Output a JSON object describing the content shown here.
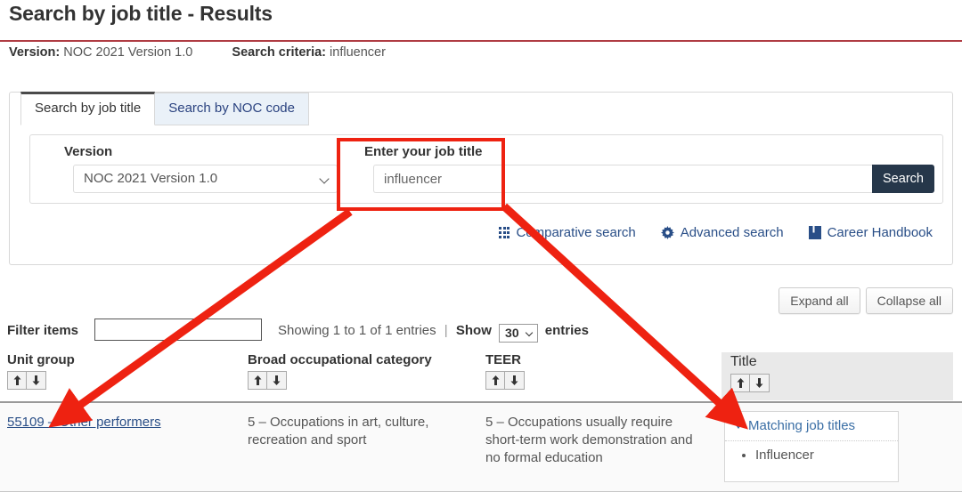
{
  "header": {
    "title": "Search by job title - Results",
    "version_label": "Version:",
    "version_value": "NOC 2021 Version 1.0",
    "criteria_label": "Search criteria:",
    "criteria_value": "influencer"
  },
  "tabs": [
    {
      "label": "Search by job title",
      "active": true
    },
    {
      "label": "Search by NOC code",
      "active": false
    }
  ],
  "form": {
    "version_label": "Version",
    "version_selected": "NOC 2021 Version 1.0",
    "jobtitle_label": "Enter your job title",
    "jobtitle_value": "influencer",
    "jobtitle_placeholder": "Enter your job title",
    "search_button": "Search"
  },
  "quick_links": [
    {
      "icon": "grid-icon",
      "label": "Comparative search"
    },
    {
      "icon": "gear-icon",
      "label": "Advanced search"
    },
    {
      "icon": "book-icon",
      "label": "Career Handbook"
    }
  ],
  "controls": {
    "expand_all": "Expand all",
    "collapse_all": "Collapse all",
    "filter_label": "Filter items",
    "filter_value": "",
    "filter_placeholder": "",
    "showing_text": "Showing 1 to 1 of 1 entries",
    "show_label": "Show",
    "show_value": "30",
    "entries_label": "entries"
  },
  "table": {
    "columns": [
      {
        "header": "Unit group",
        "sortable": true
      },
      {
        "header": "Broad occupational category",
        "sortable": true
      },
      {
        "header": "TEER",
        "sortable": true
      },
      {
        "header": "Title",
        "sortable": true
      }
    ],
    "rows": [
      {
        "unit_group": "55109 – Other performers",
        "broad_category": "5 – Occupations in art, culture, recreation and sport",
        "teer": "5 – Occupations usually require short-term work demonstration and no formal education",
        "title_toggle": "Matching job titles",
        "title_items": [
          "Influencer"
        ]
      }
    ]
  },
  "colors": {
    "accent_red": "#af3c43",
    "link_blue": "#294e87",
    "button_navy": "#26374a",
    "annotation_red": "#ee2211",
    "header_gray": "#e9e9e9"
  }
}
